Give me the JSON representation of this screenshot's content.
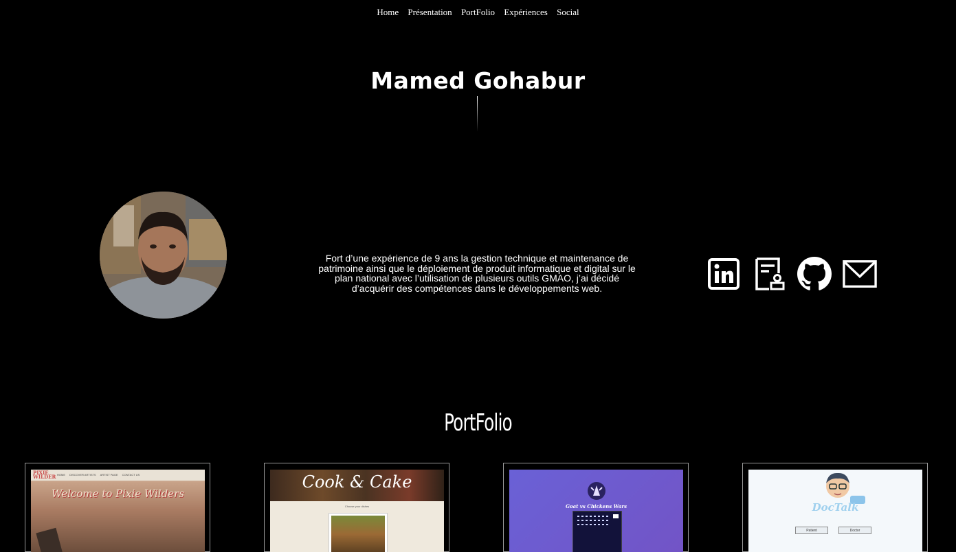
{
  "nav": {
    "items": [
      "Home",
      "Présentation",
      "PortFolio",
      "Expériences",
      "Social"
    ]
  },
  "hero": {
    "name": "Mamed Gohabur"
  },
  "about": {
    "text": "Fort d’une expérience de 9 ans la gestion technique et maintenance de patrimoine ainsi que le déploiement de produit informatique et digital sur le plan national avec l’utilisation de plusieurs outils GMAO, j’ai décidé d’acquérir des compétences dans le développements web."
  },
  "social_icons": [
    "linkedin-icon",
    "resume-icon",
    "github-icon",
    "mail-icon"
  ],
  "portfolio": {
    "title": "PortFolio",
    "projects": [
      {
        "headline": "Welcome to Pixie Wilders",
        "logo": "PIXIE WILDER",
        "menu": [
          "HOME",
          "DISCOVER ARTISTS",
          "ARTIST PAGE",
          "CONTACT US"
        ]
      },
      {
        "headline": "Cook & Cake",
        "subtitle": "Choose your dishes"
      },
      {
        "headline": "Goat vs Chickens Wars"
      },
      {
        "headline": "DocTalk",
        "buttons": [
          "Patient",
          "Doctor"
        ]
      }
    ]
  }
}
